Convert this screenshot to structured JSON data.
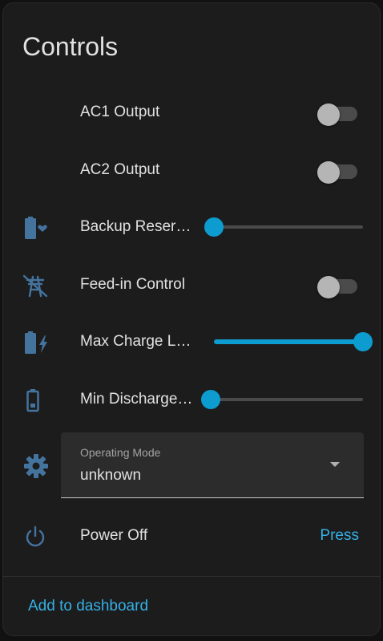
{
  "card": {
    "title": "Controls",
    "footer_link": "Add to dashboard"
  },
  "colors": {
    "accent": "#0d9ccf",
    "link": "#35b0e6",
    "icon": "#44739e",
    "background": "#1c1c1c"
  },
  "rows": [
    {
      "label": "AC1 Output",
      "type": "toggle",
      "state": "off"
    },
    {
      "label": "AC2 Output",
      "type": "toggle",
      "state": "off"
    },
    {
      "label": "Backup Reser…",
      "type": "slider",
      "icon": "battery-heart-icon",
      "level": 0
    },
    {
      "label": "Feed-in Control",
      "type": "toggle",
      "icon": "transmission-tower-off-icon",
      "state": "off"
    },
    {
      "label": "Max Charge L…",
      "type": "slider",
      "icon": "battery-charging-icon",
      "level": 1
    },
    {
      "label": "Min Discharge…",
      "type": "slider",
      "icon": "battery-outline-icon",
      "level": 0
    },
    {
      "label": "Power Off",
      "type": "button",
      "icon": "power-icon",
      "button_label": "Press"
    }
  ],
  "operating_mode": {
    "icon": "gear-icon",
    "label": "Operating Mode",
    "value": "unknown"
  }
}
